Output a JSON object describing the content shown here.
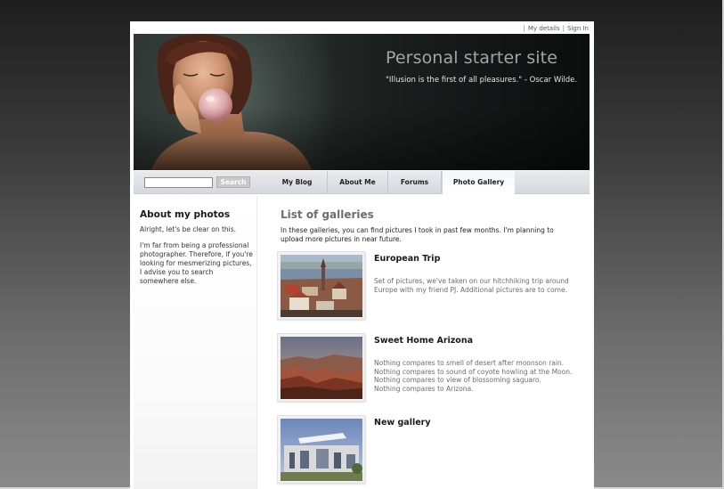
{
  "header": {
    "links": [
      {
        "label": "My details"
      },
      {
        "label": "Sign In"
      }
    ],
    "site_title": "Personal starter site",
    "quote": "\"Illusion is the first of all pleasures.\" - Oscar Wilde."
  },
  "navbar": {
    "search_placeholder": "",
    "search_button": "Search",
    "items": [
      {
        "label": "My Blog"
      },
      {
        "label": "About Me"
      },
      {
        "label": "Forums"
      },
      {
        "label": "Photo Gallery"
      }
    ],
    "active": "Photo Gallery"
  },
  "sidebar": {
    "title": "About my photos",
    "paragraphs": [
      "Alright, let's be clear on this.",
      "I'm far from being a professional photographer. Therefore, if you're looking for mesmerizing pictures, I advise you to search somewhere else."
    ]
  },
  "main": {
    "title": "List of galleries",
    "intro": "In these galleries, you can find pictures I took in past few months. I'm planning to upload more pictures in near future.",
    "galleries": [
      {
        "title": "European Trip",
        "description_lines": [
          "Set of pictures, we've taken on our hitchhiking trip around",
          "Europe with my friend PJ. Additional pictures are to come."
        ]
      },
      {
        "title": "Sweet Home Arizona",
        "description_lines": [
          "Nothing compares to smell of desert after moonson rain.",
          "Nothing compares to sound of coyote howling at the Moon.",
          "Nothing compares to view of blossoming saguaro.",
          "Nothing compares to Arizona."
        ]
      },
      {
        "title": "New gallery",
        "description_lines": []
      }
    ]
  },
  "colors": {
    "page_background": "#ffffff",
    "navbar": "#dcdee4",
    "heading_gray": "#6a6d75",
    "banner_title": "#9fa8a4"
  }
}
